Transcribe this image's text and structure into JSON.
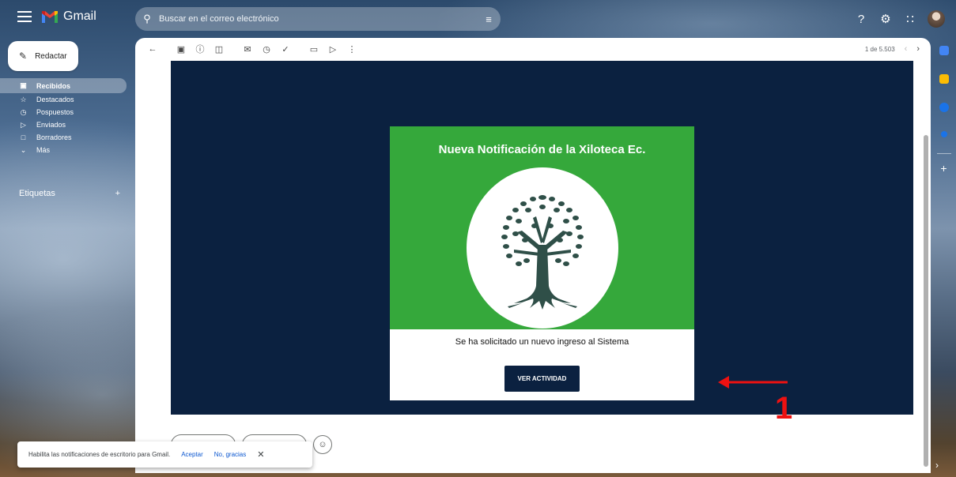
{
  "app": {
    "name": "Gmail"
  },
  "search": {
    "placeholder": "Buscar en el correo electrónico"
  },
  "compose": {
    "label": "Redactar"
  },
  "sidebar": {
    "items": [
      {
        "label": "Recibidos",
        "icon": "inbox-icon"
      },
      {
        "label": "Destacados",
        "icon": "star-icon"
      },
      {
        "label": "Pospuestos",
        "icon": "clock-icon"
      },
      {
        "label": "Enviados",
        "icon": "send-icon"
      },
      {
        "label": "Borradores",
        "icon": "draft-icon"
      },
      {
        "label": "Más",
        "icon": "chevron-down-icon"
      }
    ],
    "labels_title": "Etiquetas"
  },
  "toolbar": {
    "pager_text": "1 de 5.503"
  },
  "email": {
    "title": "Nueva Notificación de la Xiloteca Ec.",
    "message": "Se ha solicitado un nuevo ingreso al Sistema",
    "button_label": "VER ACTIVIDAD",
    "annotation_number": "1",
    "colors": {
      "background": "#0b2140",
      "banner": "#35a83b",
      "button": "#0b2140",
      "annotation": "#ee1111"
    }
  },
  "snackbar": {
    "text": "Habilita las notificaciones de escritorio para Gmail.",
    "accept": "Aceptar",
    "decline": "No, gracias"
  }
}
